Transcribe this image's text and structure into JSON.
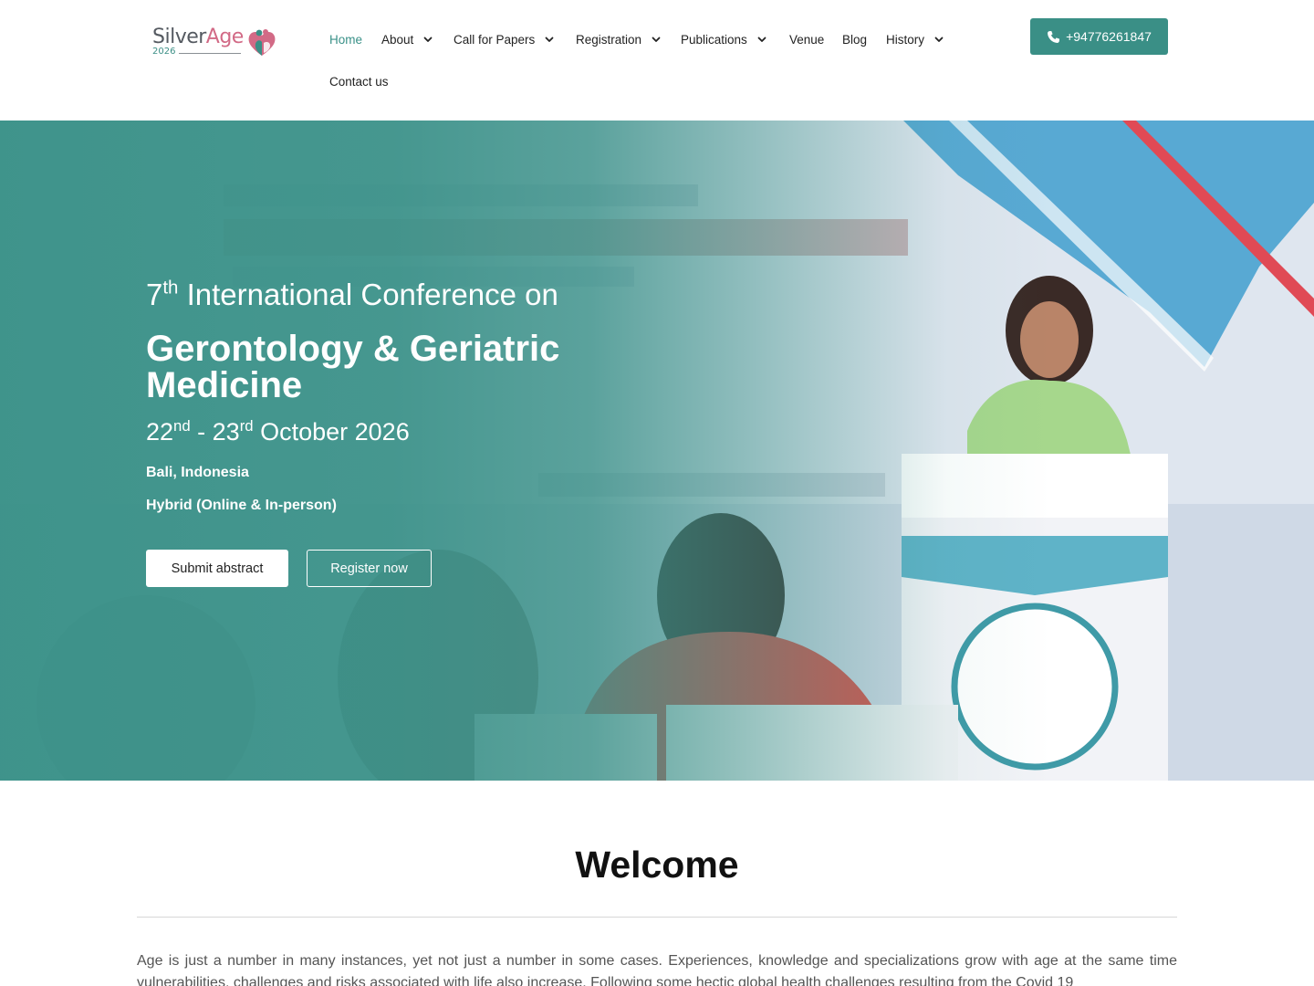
{
  "brand": {
    "logo_word_1": "Silver",
    "logo_word_2": "Age",
    "logo_year": "2026"
  },
  "nav": {
    "items": [
      {
        "label": "Home",
        "active": true,
        "dropdown": false
      },
      {
        "label": "About",
        "active": false,
        "dropdown": true
      },
      {
        "label": "Call for Papers",
        "active": false,
        "dropdown": true
      },
      {
        "label": "Registration",
        "active": false,
        "dropdown": true
      },
      {
        "label": "Publications",
        "active": false,
        "dropdown": true
      },
      {
        "label": "Venue",
        "active": false,
        "dropdown": false
      },
      {
        "label": "Blog",
        "active": false,
        "dropdown": false
      },
      {
        "label": "History",
        "active": false,
        "dropdown": true
      },
      {
        "label": "Contact us",
        "active": false,
        "dropdown": false
      }
    ],
    "phone": "+94776261847"
  },
  "hero": {
    "ordinal_number": "7",
    "ordinal_suffix": "th",
    "line1_rest": " International Conference on",
    "title": "Gerontology & Geriatric Medicine",
    "date_day1": "22",
    "date_suffix1": "nd",
    "date_sep": " - 23",
    "date_suffix2": "rd",
    "date_rest": " October 2026",
    "location": "Bali, Indonesia",
    "mode": "Hybrid (Online & In-person)",
    "submit_label": "Submit abstract",
    "register_label": "Register now"
  },
  "welcome": {
    "title": "Welcome",
    "text": "Age is just a number in many instances, yet not just a number in some cases. Experiences, knowledge and specializations grow with age at the same time vulnerabilities, challenges and risks associated with life also increase. Following some hectic global health challenges resulting from the Covid 19"
  },
  "colors": {
    "accent": "#3a8f86",
    "brand_pink": "#d26a86",
    "text_dark": "#222222"
  },
  "icons": {
    "phone": "phone-icon",
    "dropdown": "chevron-down-icon",
    "logo": "heart-people-icon"
  }
}
